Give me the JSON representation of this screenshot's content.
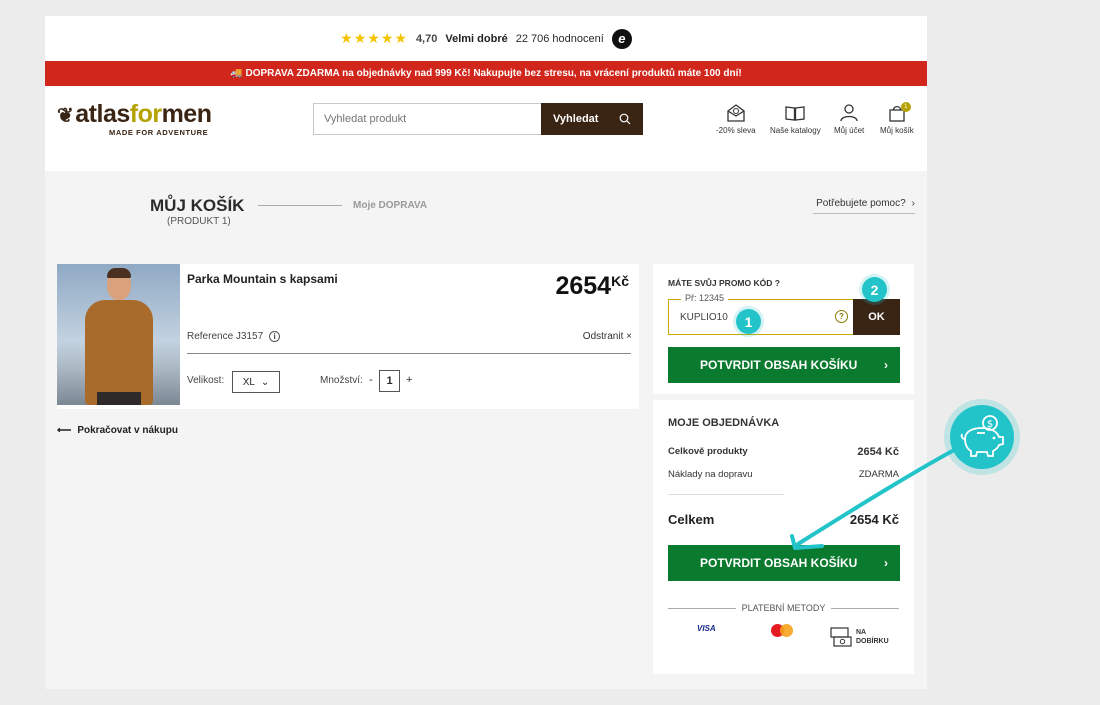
{
  "topbar": {
    "stars": "★★★★★",
    "rating": "4,70",
    "verdict": "Velmi dobré",
    "reviews": "22 706 hodnocení",
    "trusted_logo": "e"
  },
  "banner": {
    "text": "🚚 DOPRAVA ZDARMA na objednávky nad 999 Kč! Nakupujte bez stresu, na vrácení produktů máte 100 dní!"
  },
  "header": {
    "logo_a": "atlas",
    "logo_b": "for",
    "logo_c": "men",
    "logo_tagline": "MADE FOR ADVENTURE",
    "search_placeholder": "Vyhledat produkt",
    "search_button": "Vyhledat",
    "nav": {
      "discount": "-20% sleva",
      "catalogs": "Naše katalogy",
      "account": "Můj účet",
      "cart": "Můj košík",
      "cart_count": "1"
    }
  },
  "breadcrumb": {
    "title": "MŮJ KOŠÍK",
    "subtitle": "(PRODUKT 1)",
    "step2": "Moje DOPRAVA",
    "help": "Potřebujete pomoc?"
  },
  "product": {
    "name": "Parka Mountain s kapsami",
    "price": "2654",
    "currency": "Kč",
    "reference": "Reference J3157",
    "remove": "Odstranit ×",
    "size_label": "Velikost:",
    "size_value": "XL",
    "qty_label": "Množství:",
    "qty_minus": "-",
    "qty_value": "1",
    "qty_plus": "+"
  },
  "continue_shopping": "Pokračovat v nákupu",
  "promo": {
    "title": "MÁTE SVŮJ PROMO KÓD ?",
    "legend": "Př: 12345",
    "value": "KUPLIO10",
    "ok": "OK",
    "confirm": "POTVRDIT OBSAH KOŠÍKU"
  },
  "order": {
    "title": "MOJE OBJEDNÁVKA",
    "products_label": "Celkově produkty",
    "products_value": "2654 Kč",
    "shipping_label": "Náklady na dopravu",
    "shipping_value": "ZDARMA",
    "total_label": "Celkem",
    "total_value": "2654 Kč",
    "confirm": "POTVRDIT OBSAH KOŠÍKU",
    "payment_title": "PLATEBNÍ METODY",
    "visa": "VISA",
    "cod_a": "NA",
    "cod_b": "DOBÍRKU"
  },
  "annotations": {
    "step1": "1",
    "step2": "2"
  },
  "colors": {
    "brand_brown": "#3a2414",
    "brand_green": "#0a7a2e",
    "banner_red": "#d1261b",
    "accent_teal": "#23c4c9",
    "logo_gold": "#b5a200"
  }
}
